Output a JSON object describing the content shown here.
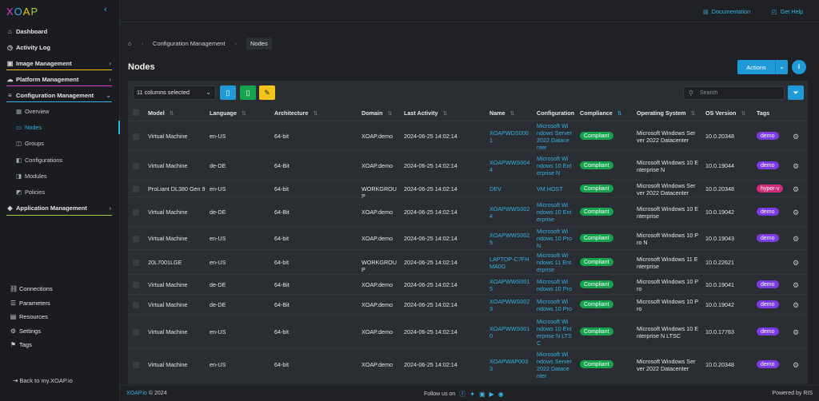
{
  "brand": {
    "logo": [
      "X",
      "O",
      "A",
      "P"
    ]
  },
  "sidebar": {
    "collapse_icon": "chevron-left-icon",
    "items": [
      {
        "label": "Dashboard",
        "icon": "home-icon",
        "icon_glyph": "⌂"
      },
      {
        "label": "Activity Log",
        "icon": "clock-icon",
        "icon_glyph": "◷"
      },
      {
        "label": "Image Management",
        "icon": "image-icon",
        "icon_glyph": "▣",
        "chevron": "›",
        "underline": "#f0c419"
      },
      {
        "label": "Platform Management",
        "icon": "cloud-icon",
        "icon_glyph": "☁",
        "chevron": "›",
        "underline": "#e23bd2"
      },
      {
        "label": "Configuration Management",
        "icon": "sliders-icon",
        "icon_glyph": "≡",
        "chevron": "⌄",
        "underline": "#37b3e6"
      }
    ],
    "sub_items": [
      {
        "label": "Overview",
        "icon_glyph": "▦"
      },
      {
        "label": "Nodes",
        "icon_glyph": "▭",
        "active": true
      },
      {
        "label": "Groups",
        "icon_glyph": "◫"
      },
      {
        "label": "Configurations",
        "icon_glyph": "◧"
      },
      {
        "label": "Modules",
        "icon_glyph": "◨"
      },
      {
        "label": "Policies",
        "icon_glyph": "◩"
      }
    ],
    "app_mgmt": {
      "label": "Application Management",
      "icon_glyph": "◆",
      "chevron": "›",
      "underline": "#9ad14b"
    },
    "bottom": [
      {
        "label": "Connections",
        "icon_glyph": "⛓"
      },
      {
        "label": "Parameters",
        "icon_glyph": "☰"
      },
      {
        "label": "Resources",
        "icon_glyph": "▤"
      },
      {
        "label": "Settings",
        "icon_glyph": "⚙"
      },
      {
        "label": "Tags",
        "icon_glyph": "⚑"
      }
    ],
    "back": "Back to my.XOAP.io"
  },
  "topbar": {
    "documentation": "Documentation",
    "get_help": "Get Help"
  },
  "breadcrumb": {
    "home_icon": "home-icon",
    "section": "Configuration Management",
    "current": "Nodes"
  },
  "page": {
    "title": "Nodes",
    "actions_label": "Actions",
    "info": "i"
  },
  "toolbar": {
    "columns_selected": "11 columns selected",
    "search_placeholder": "Search",
    "export_colors": [
      "#1f9ad6",
      "#14a44d",
      "#f0c419"
    ]
  },
  "table": {
    "headers": [
      "Model",
      "Language",
      "Architecture",
      "Domain",
      "Last Activity",
      "Name",
      "Configuration",
      "Compliance",
      "Operating System",
      "OS Version",
      "Tags"
    ],
    "rows": [
      {
        "model": "Virtual Machine",
        "lang": "en-US",
        "arch": "64-bit",
        "domain": "XOAP.demo",
        "last": "2024-06-25 14:02:14",
        "name": [
          "XOAPWDS000",
          "1"
        ],
        "config": [
          "Microsoft Wi",
          "ndows Server",
          "2022 Datace",
          "nter"
        ],
        "comp": "Compliant",
        "os": [
          "Microsoft Windows Ser",
          "ver 2022 Datacenter"
        ],
        "osv": "10.0.20348",
        "tag": "demo",
        "tag_color": "#7b3be6",
        "h": 37
      },
      {
        "model": "Virtual Machine",
        "lang": "de-DE",
        "arch": "64-Bit",
        "domain": "XOAP.demo",
        "last": "2024-06-25 14:02:14",
        "name": [
          "XOAPWWS004",
          "4"
        ],
        "config": [
          "Microsoft Wi",
          "ndows 10 Ent",
          "erprise N"
        ],
        "comp": "Compliant",
        "os": [
          "Microsoft Windows 10 E",
          "nterprise N"
        ],
        "osv": "10.0.19044",
        "tag": "demo",
        "tag_color": "#7b3be6",
        "h": 37
      },
      {
        "model": "ProLiant DL380 Gen 9",
        "lang": "en-US",
        "arch": "64-bit",
        "domain": "WORKGROU P",
        "last": "2024-06-25 14:02:14",
        "name": [
          "DEV"
        ],
        "config": [
          "VM HOST"
        ],
        "comp": "Compliant",
        "os": [
          "Microsoft Windows Ser",
          "ver 2022 Datacenter"
        ],
        "osv": "10.0.20348",
        "tag": "hyper-v",
        "tag_color": "#d12d7a",
        "h": 21
      },
      {
        "model": "Virtual Machine",
        "lang": "de-DE",
        "arch": "64-Bit",
        "domain": "XOAP.demo",
        "last": "2024-06-25 14:02:14",
        "name": [
          "XOAPWWS002",
          "4"
        ],
        "config": [
          "Microsoft Wi",
          "ndows 10 Ent",
          "erprise"
        ],
        "comp": "Compliant",
        "os": [
          "Microsoft Windows 10 E",
          "nterprise"
        ],
        "osv": "10.0.19042",
        "tag": "demo",
        "tag_color": "#7b3be6",
        "h": 37
      },
      {
        "model": "Virtual Machine",
        "lang": "en-US",
        "arch": "64-bit",
        "domain": "XOAP.demo",
        "last": "2024-06-25 14:02:14",
        "name": [
          "XOAPWWS002",
          "5"
        ],
        "config": [
          "Microsoft Wi",
          "ndows 10 Pro",
          "N"
        ],
        "comp": "Compliant",
        "os": [
          "Microsoft Windows 10 P",
          "ro N"
        ],
        "osv": "10.0.19043",
        "tag": "demo",
        "tag_color": "#7b3be6",
        "h": 29
      },
      {
        "model": "20L7001LGE",
        "lang": "en-US",
        "arch": "64-bit",
        "domain": "WORKGROU P",
        "last": "2024-06-25 14:02:14",
        "name": [
          "LAPTOP-C7FH",
          "MA0G"
        ],
        "config": [
          "Microsoft Wi",
          "ndows 11 Ent",
          "erprise"
        ],
        "comp": "Compliant",
        "os": [
          "Microsoft Windows 11 E",
          "nterprise"
        ],
        "osv": "10.0.22621",
        "tag": "",
        "tag_color": "",
        "h": 31
      },
      {
        "model": "Virtual Machine",
        "lang": "de-DE",
        "arch": "64-Bit",
        "domain": "XOAP.demo",
        "last": "2024-06-25 14:02:14",
        "name": [
          "XOAPWWS001",
          "5"
        ],
        "config": [
          "Microsoft Wi",
          "ndows 10 Pro"
        ],
        "comp": "Compliant",
        "os": [
          "Microsoft Windows 10 P",
          "ro"
        ],
        "osv": "10.0.19041",
        "tag": "demo",
        "tag_color": "#7b3be6",
        "h": 25
      },
      {
        "model": "Virtual Machine",
        "lang": "de-DE",
        "arch": "64-Bit",
        "domain": "XOAP.demo",
        "last": "2024-06-25 14:02:14",
        "name": [
          "XOAPWWS002",
          "3"
        ],
        "config": [
          "Microsoft Wi",
          "ndows 10 Pro"
        ],
        "comp": "Compliant",
        "os": [
          "Microsoft Windows 10 P",
          "ro"
        ],
        "osv": "10.0.19042",
        "tag": "demo",
        "tag_color": "#7b3be6",
        "h": 25
      },
      {
        "model": "Virtual Machine",
        "lang": "en-US",
        "arch": "64-bit",
        "domain": "XOAP.demo",
        "last": "2024-06-25 14:02:14",
        "name": [
          "XOAPWWS001",
          "0"
        ],
        "config": [
          "Microsoft Wi",
          "ndows 10 Ent",
          "erprise N LTS",
          "C"
        ],
        "comp": "Compliant",
        "os": [
          "Microsoft Windows 10 E",
          "nterprise N LTSC"
        ],
        "osv": "10.0.17763",
        "tag": "demo",
        "tag_color": "#7b3be6",
        "h": 43
      },
      {
        "model": "Virtual Machine",
        "lang": "en-US",
        "arch": "64-bit",
        "domain": "XOAP.demo",
        "last": "2024-06-25 14:02:14",
        "name": [
          "XOAPWAP003",
          "3"
        ],
        "config": [
          "Microsoft Wi",
          "ndows Server",
          "2022 Datace",
          "nter"
        ],
        "comp": "Compliant",
        "os": [
          "Microsoft Windows Ser",
          "ver 2022 Datacenter"
        ],
        "osv": "10.0.20348",
        "tag": "demo",
        "tag_color": "#7b3be6",
        "h": 39
      }
    ]
  },
  "footer": {
    "brand": "XOAP.io",
    "copyright": "© 2024",
    "follow": "Follow us on",
    "powered": "Powered by RIS"
  }
}
